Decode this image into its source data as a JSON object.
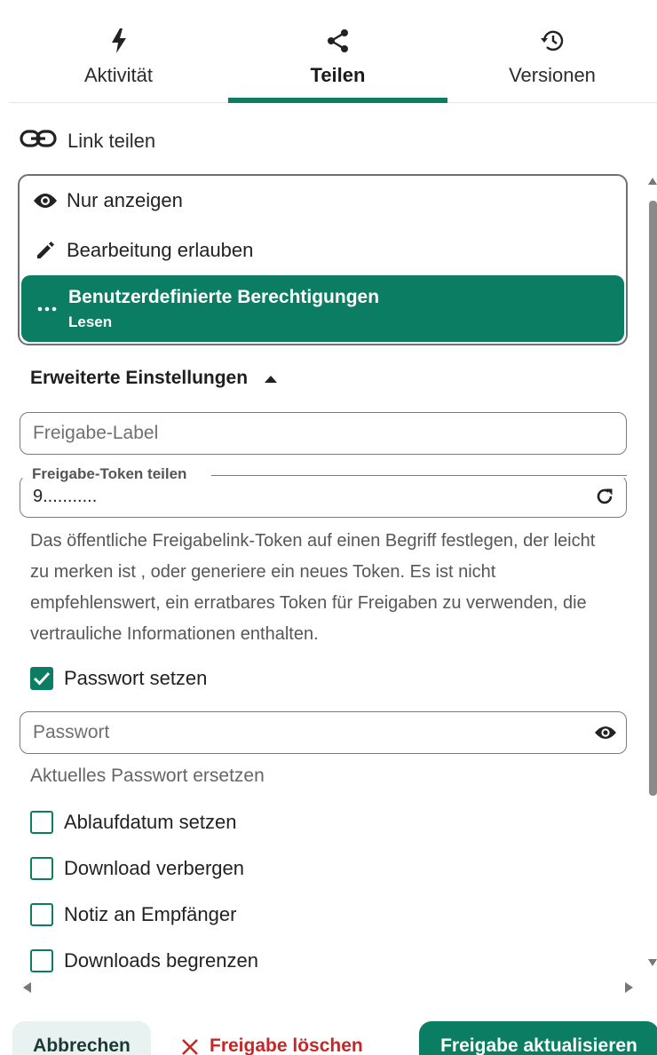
{
  "tabs": [
    {
      "label": "Aktivität",
      "icon": "lightning-icon"
    },
    {
      "label": "Teilen",
      "icon": "share-icon",
      "active": true
    },
    {
      "label": "Versionen",
      "icon": "history-icon"
    }
  ],
  "section": {
    "title": "Link teilen",
    "icon": "link-icon"
  },
  "permissions": {
    "view_only": "Nur anzeigen",
    "allow_edit": "Bearbeitung erlauben",
    "custom": "Benutzerdefinierte Berechtigungen",
    "custom_sub": "Lesen"
  },
  "advanced": {
    "title": "Erweiterte Einstellungen"
  },
  "share_label": {
    "placeholder": "Freigabe-Label"
  },
  "share_token": {
    "label": "Freigabe-Token teilen",
    "value": "9..........."
  },
  "help_text": "Das öffentliche Freigabelink-Token auf einen Begriff festlegen, der leicht zu merken ist , oder generiere ein neues Token. Es ist nicht empfehlenswert, ein erratbares Token für Freigaben zu verwenden, die vertrauliche Informationen enthalten.",
  "password": {
    "checkbox_label": "Passwort setzen",
    "checked": true,
    "placeholder": "Passwort",
    "hint": "Aktuelles Passwort ersetzen"
  },
  "options": [
    {
      "label": "Ablaufdatum setzen",
      "checked": false
    },
    {
      "label": "Download verbergen",
      "checked": false
    },
    {
      "label": "Notiz an Empfänger",
      "checked": false
    },
    {
      "label": "Downloads begrenzen",
      "checked": false
    }
  ],
  "buttons": {
    "cancel": "Abbrechen",
    "delete": "Freigabe löschen",
    "update": "Freigabe aktualisieren"
  },
  "colors": {
    "accent": "#0b7d63",
    "danger": "#c62828"
  }
}
